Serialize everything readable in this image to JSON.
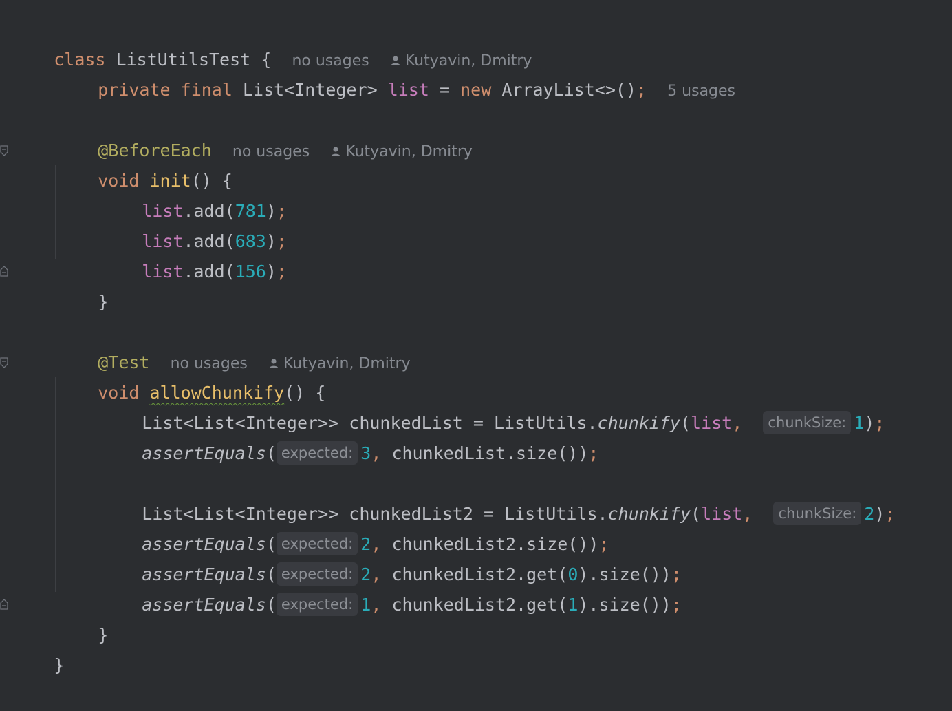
{
  "code": {
    "line1": {
      "kw_class": "class",
      "class_name": "ListUtilsTest",
      "brace": "{"
    },
    "line1_hints": {
      "usages": "no usages",
      "author": "Kutyavin, Dmitry"
    },
    "line2": {
      "kw_private": "private",
      "kw_final": "final",
      "type": "List<Integer>",
      "field": "list",
      "eq": "=",
      "kw_new": "new",
      "ctor": "ArrayList<>()",
      "semi": ";"
    },
    "line2_hints": {
      "usages": "5 usages"
    },
    "line4": {
      "annotation": "@BeforeEach"
    },
    "line4_hints": {
      "usages": "no usages",
      "author": "Kutyavin, Dmitry"
    },
    "line5": {
      "kw_void": "void",
      "method": "init",
      "rest": "() {"
    },
    "line6": {
      "field": "list",
      "call": ".add(",
      "num": "781",
      "close": ")",
      "semi": ";"
    },
    "line7": {
      "field": "list",
      "call": ".add(",
      "num": "683",
      "close": ")",
      "semi": ";"
    },
    "line8": {
      "field": "list",
      "call": ".add(",
      "num": "156",
      "close": ")",
      "semi": ";"
    },
    "line9": {
      "brace": "}"
    },
    "line11": {
      "annotation": "@Test"
    },
    "line11_hints": {
      "usages": "no usages",
      "author": "Kutyavin, Dmitry"
    },
    "line12": {
      "kw_void": "void",
      "method": "allowChunkify",
      "rest": "() {"
    },
    "line13": {
      "type": "List<List<Integer>>",
      "var": "chunkedList",
      "eq": "=",
      "cls": "ListUtils.",
      "fn": "chunkify",
      "open": "(",
      "field": "list",
      "comma": ",",
      "hint": "chunkSize:",
      "num": "1",
      "close": ")",
      "semi": ";"
    },
    "line14": {
      "fn": "assertEquals",
      "open": "(",
      "hint": "expected:",
      "num": "3",
      "comma": ",",
      "rest": "chunkedList.size())",
      "semi": ";"
    },
    "line16": {
      "type": "List<List<Integer>>",
      "var": "chunkedList2",
      "eq": "=",
      "cls": "ListUtils.",
      "fn": "chunkify",
      "open": "(",
      "field": "list",
      "comma": ",",
      "hint": "chunkSize:",
      "num": "2",
      "close": ")",
      "semi": ";"
    },
    "line17": {
      "fn": "assertEquals",
      "open": "(",
      "hint": "expected:",
      "num": "2",
      "comma": ",",
      "rest": "chunkedList2.size())",
      "semi": ";"
    },
    "line18": {
      "fn": "assertEquals",
      "open": "(",
      "hint": "expected:",
      "num": "2",
      "comma": ",",
      "rest_a": "chunkedList2.get(",
      "idx": "0",
      "rest_b": ").size())",
      "semi": ";"
    },
    "line19": {
      "fn": "assertEquals",
      "open": "(",
      "hint": "expected:",
      "num": "1",
      "comma": ",",
      "rest_a": "chunkedList2.get(",
      "idx": "1",
      "rest_b": ").size())",
      "semi": ";"
    },
    "line20": {
      "brace": "}"
    },
    "line21": {
      "brace": "}"
    }
  },
  "colors": {
    "background": "#2b2d30",
    "keyword": "#cf8e6d",
    "field": "#c77dbb",
    "number": "#2aacb8",
    "annotation": "#b3ae60",
    "method_decl": "#e8bf6a",
    "hint_text": "#868a91",
    "inlay_bg": "#393b40"
  },
  "icons": {
    "author": "person-icon",
    "fold": "fold-marker-icon"
  }
}
